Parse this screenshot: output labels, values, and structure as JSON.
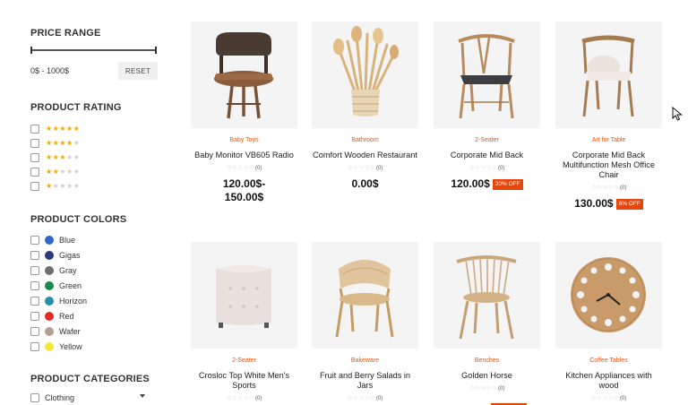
{
  "filters": {
    "price": {
      "title": "PRICE RANGE",
      "value": "0$ - 1000$",
      "reset_label": "RESET",
      "range_min": 0,
      "range_max": 1000
    },
    "rating": {
      "title": "PRODUCT RATING",
      "levels": [
        5,
        4,
        3,
        2,
        1
      ]
    },
    "colors": {
      "title": "PRODUCT COLORS",
      "items": [
        {
          "name": "Blue",
          "hex": "#2f67c6"
        },
        {
          "name": "Gigas",
          "hex": "#2b3a7c"
        },
        {
          "name": "Gray",
          "hex": "#6e6e73"
        },
        {
          "name": "Green",
          "hex": "#178a4a"
        },
        {
          "name": "Horizon",
          "hex": "#2590a8"
        },
        {
          "name": "Red",
          "hex": "#e32b22"
        },
        {
          "name": "Wafer",
          "hex": "#b19f92"
        },
        {
          "name": "Yellow",
          "hex": "#f5e63a"
        }
      ]
    },
    "categories": {
      "title": "PRODUCT CATEGORIES",
      "items": [
        "Clothing"
      ]
    }
  },
  "products": [
    {
      "category": "Baby Toys",
      "name": "Baby Monitor VB605 Radio",
      "rating_count": "(0)",
      "price": "120.00$-",
      "price2": "150.00$",
      "badge": "",
      "image": "lounge-chair"
    },
    {
      "category": "Bathroom",
      "name": "Comfort Wooden Restaurant",
      "rating_count": "(0)",
      "price": "0.00$",
      "price2": "",
      "badge": "",
      "image": "wooden-utensils"
    },
    {
      "category": "2-Seater",
      "name": "Corporate Mid Back",
      "rating_count": "(0)",
      "price": "120.00$",
      "price2": "",
      "badge": "20% OFF",
      "image": "wishbone-chair"
    },
    {
      "category": "Art for Table",
      "name": "Corporate Mid Back Multifunction Mesh Office Chair",
      "rating_count": "(0)",
      "price": "130.00$",
      "price2": "",
      "badge": "6% OFF",
      "image": "dining-chair"
    },
    {
      "category": "2-Seater",
      "name": "Crosloc Top White Men's Sports",
      "rating_count": "(0)",
      "price": "",
      "price2": "",
      "badge": "",
      "image": "tufted-ottoman"
    },
    {
      "category": "Bakeware",
      "name": "Fruit and Berry Salads in Jars",
      "rating_count": "(0)",
      "price": "",
      "price2": "",
      "badge": "",
      "image": "cane-armchair"
    },
    {
      "category": "Benches",
      "name": "Golden Horse",
      "rating_count": "(0)",
      "price": "",
      "price2": "",
      "badge": "",
      "image": "spindle-chair"
    },
    {
      "category": "Coffee Tables",
      "name": "Kitchen Appliances with wood",
      "rating_count": "(0)",
      "price": "",
      "price2": "",
      "badge": "",
      "image": "wall-clock"
    }
  ]
}
